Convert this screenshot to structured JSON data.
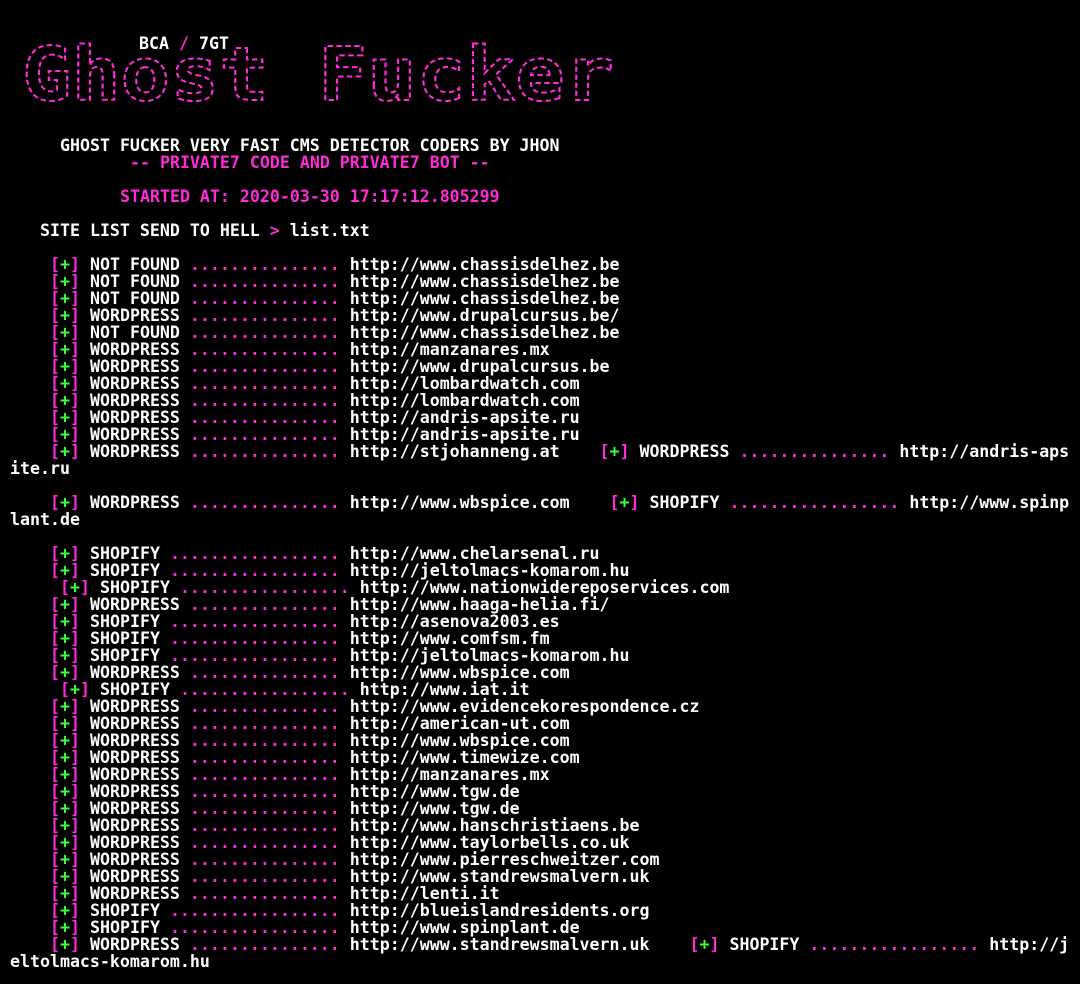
{
  "banner": {
    "logo_text": "Ghost Fucker",
    "bca": "BCA",
    "slash": "/",
    "tgt": "7GT",
    "color": "#ff2bd6"
  },
  "header": {
    "title": "GHOST FUCKER VERY FAST CMS DETECTOR CODERS BY JHON",
    "subtitle": "-- PRIVATE7 CODE AND PRIVATE7 BOT --",
    "started": "STARTED AT: 2020-03-30 17:17:12.805299",
    "prompt_label": "SITE LIST SEND TO HELL",
    "prompt_arrow": ">",
    "prompt_file": "list.txt"
  },
  "colors": {
    "background": "#000000",
    "accent": "#ff2bd6",
    "plus": "#3cff3c",
    "text": "#ffffff"
  },
  "lines": [
    {
      "t": "a",
      "s": "NOT FOUND",
      "d": "...............",
      "u": "http://www.chassisdelhez.be"
    },
    {
      "t": "a",
      "s": "NOT FOUND",
      "d": "...............",
      "u": "http://www.chassisdelhez.be"
    },
    {
      "t": "a",
      "s": "NOT FOUND",
      "d": "...............",
      "u": "http://www.chassisdelhez.be"
    },
    {
      "t": "a",
      "s": "WORDPRESS",
      "d": "...............",
      "u": "http://www.drupalcursus.be/"
    },
    {
      "t": "a",
      "s": "NOT FOUND",
      "d": "...............",
      "u": "http://www.chassisdelhez.be"
    },
    {
      "t": "a",
      "s": "WORDPRESS",
      "d": "...............",
      "u": "http://manzanares.mx"
    },
    {
      "t": "a",
      "s": "WORDPRESS",
      "d": "...............",
      "u": "http://www.drupalcursus.be"
    },
    {
      "t": "a",
      "s": "WORDPRESS",
      "d": "...............",
      "u": "http://lombardwatch.com"
    },
    {
      "t": "a",
      "s": "WORDPRESS",
      "d": "...............",
      "u": "http://lombardwatch.com"
    },
    {
      "t": "a",
      "s": "WORDPRESS",
      "d": "...............",
      "u": "http://andris-apsite.ru"
    },
    {
      "t": "a",
      "s": "WORDPRESS",
      "d": "...............",
      "u": "http://andris-apsite.ru"
    },
    {
      "t": "b",
      "s": "WORDPRESS",
      "d": "...............",
      "u": "http://stjohanneng.at",
      "s2": "WORDPRESS",
      "d2": "...............",
      "u2": "http://andris-aps"
    },
    {
      "t": "c",
      "x": "ite.ru"
    },
    {
      "t": "e"
    },
    {
      "t": "b",
      "s": "WORDPRESS",
      "d": "...............",
      "u": "http://www.wbspice.com",
      "s2": "SHOPIFY",
      "d2": ".................",
      "u2": "http://www.spinp"
    },
    {
      "t": "c",
      "x": "lant.de"
    },
    {
      "t": "e"
    },
    {
      "t": "a",
      "s": "SHOPIFY",
      "d": ".................",
      "u": "http://www.chelarsenal.ru"
    },
    {
      "t": "a",
      "s": "SHOPIFY",
      "d": ".................",
      "u": "http://jeltolmacs-komarom.hu"
    },
    {
      "t": "a2",
      "s": "SHOPIFY",
      "d": ".................",
      "u": "http://www.nationwidereposervices.com"
    },
    {
      "t": "a",
      "s": "WORDPRESS",
      "d": "...............",
      "u": "http://www.haaga-helia.fi/"
    },
    {
      "t": "a",
      "s": "SHOPIFY",
      "d": ".................",
      "u": "http://asenova2003.es"
    },
    {
      "t": "a",
      "s": "SHOPIFY",
      "d": ".................",
      "u": "http://www.comfsm.fm"
    },
    {
      "t": "a",
      "s": "SHOPIFY",
      "d": ".................",
      "u": "http://jeltolmacs-komarom.hu"
    },
    {
      "t": "a",
      "s": "WORDPRESS",
      "d": "...............",
      "u": "http://www.wbspice.com"
    },
    {
      "t": "a2",
      "s": "SHOPIFY",
      "d": ".................",
      "u": "http://www.iat.it"
    },
    {
      "t": "a",
      "s": "WORDPRESS",
      "d": "...............",
      "u": "http://www.evidencekorespondence.cz"
    },
    {
      "t": "a",
      "s": "WORDPRESS",
      "d": "...............",
      "u": "http://american-ut.com"
    },
    {
      "t": "a",
      "s": "WORDPRESS",
      "d": "...............",
      "u": "http://www.wbspice.com"
    },
    {
      "t": "a",
      "s": "WORDPRESS",
      "d": "...............",
      "u": "http://www.timewize.com"
    },
    {
      "t": "a",
      "s": "WORDPRESS",
      "d": "...............",
      "u": "http://manzanares.mx"
    },
    {
      "t": "a",
      "s": "WORDPRESS",
      "d": "...............",
      "u": "http://www.tgw.de"
    },
    {
      "t": "a",
      "s": "WORDPRESS",
      "d": "...............",
      "u": "http://www.tgw.de"
    },
    {
      "t": "a",
      "s": "WORDPRESS",
      "d": "...............",
      "u": "http://www.hanschristiaens.be"
    },
    {
      "t": "a",
      "s": "WORDPRESS",
      "d": "...............",
      "u": "http://www.taylorbells.co.uk"
    },
    {
      "t": "a",
      "s": "WORDPRESS",
      "d": "...............",
      "u": "http://www.pierreschweitzer.com"
    },
    {
      "t": "a",
      "s": "WORDPRESS",
      "d": "...............",
      "u": "http://www.standrewsmalvern.uk"
    },
    {
      "t": "a",
      "s": "WORDPRESS",
      "d": "...............",
      "u": "http://lenti.it"
    },
    {
      "t": "a",
      "s": "SHOPIFY",
      "d": ".................",
      "u": "http://blueislandresidents.org"
    },
    {
      "t": "a",
      "s": "SHOPIFY",
      "d": ".................",
      "u": "http://www.spinplant.de"
    },
    {
      "t": "b",
      "s": "WORDPRESS",
      "d": "...............",
      "u": "http://www.standrewsmalvern.uk",
      "s2": "SHOPIFY",
      "d2": ".................",
      "u2": "http://j"
    },
    {
      "t": "c",
      "x": "eltolmacs-komarom.hu"
    }
  ]
}
